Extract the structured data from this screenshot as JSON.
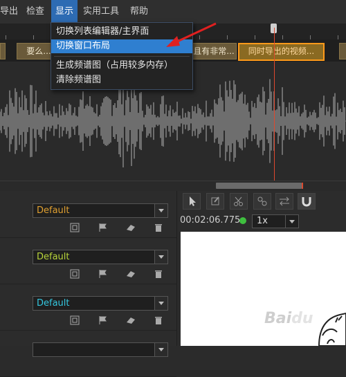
{
  "menubar": {
    "items": [
      {
        "label": "导出",
        "active": false
      },
      {
        "label": "检查",
        "active": false
      },
      {
        "label": "显示",
        "active": true
      },
      {
        "label": "实用工具",
        "active": false
      },
      {
        "label": "帮助",
        "active": false
      }
    ]
  },
  "dropdown": {
    "items": [
      {
        "label": "切换列表编辑器/主界面",
        "highlighted": false
      },
      {
        "label": "切换窗口布局",
        "highlighted": true
      },
      {
        "label": "生成频谱图（占用较多内存）",
        "highlighted": false
      },
      {
        "label": "清除频谱图",
        "highlighted": false
      }
    ]
  },
  "clips": [
    {
      "label": "要么..."
    },
    {
      "label": "且有非常..."
    },
    {
      "label": "同时导出的视频...",
      "selected": true
    }
  ],
  "tracks": [
    {
      "label": "Default",
      "color": "#e0a030"
    },
    {
      "label": "Default",
      "color": "#b8d43a"
    },
    {
      "label": "Default",
      "color": "#34c8e0"
    }
  ],
  "right_panel": {
    "timecode": "00:02:06.775",
    "zoom": "1x"
  },
  "watermark": "Baidu",
  "colors": {
    "accent": "#2f7fd0",
    "playhead": "#e0482e",
    "selected_clip_border": "#ff9a1a",
    "annotation_arrow": "#e02020"
  }
}
